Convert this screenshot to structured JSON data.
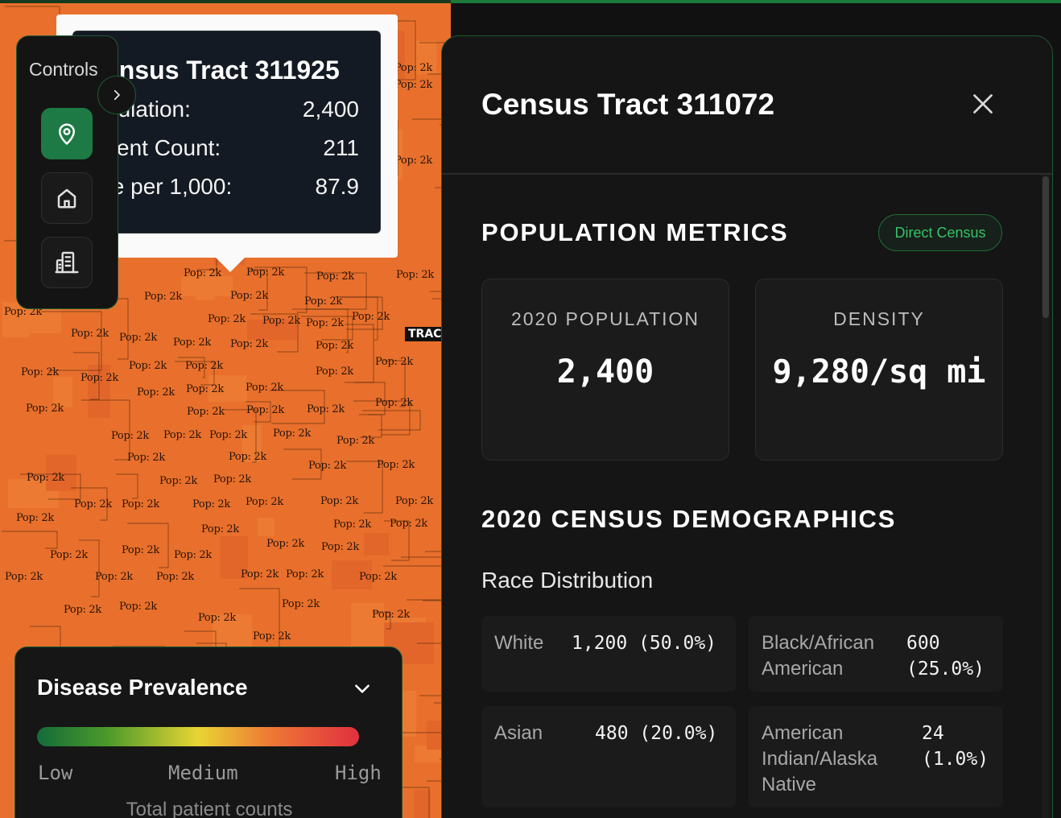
{
  "map": {
    "tract_label": "Pop: 2k",
    "selected_badge": "TRAC",
    "colors": {
      "fill": "#e8702c",
      "border": "#3a1a08"
    }
  },
  "tooltip": {
    "title": "ensus Tract 311925",
    "rows": [
      {
        "label": "pulation:",
        "value": "2,400"
      },
      {
        "label": "tient Count:",
        "value": "211"
      },
      {
        "label": "te per 1,000:",
        "value": "87.9"
      }
    ]
  },
  "controls": {
    "title": "Controls",
    "buttons": [
      {
        "icon": "map-pin-icon",
        "active": true
      },
      {
        "icon": "home-icon",
        "active": false
      },
      {
        "icon": "building-icon",
        "active": false
      }
    ]
  },
  "legend": {
    "title": "Disease Prevalence",
    "low": "Low",
    "medium": "Medium",
    "high": "High",
    "subtitle": "Total patient counts"
  },
  "panel": {
    "title": "Census Tract 311072",
    "population_metrics": {
      "heading": "POPULATION METRICS",
      "badge": "Direct Census",
      "cards": [
        {
          "label": "2020 POPULATION",
          "value": "2,400"
        },
        {
          "label": "DENSITY",
          "value": "9,280/sq mi"
        }
      ]
    },
    "demographics": {
      "heading": "2020 CENSUS DEMOGRAPHICS",
      "race_heading": "Race Distribution",
      "race": [
        {
          "name": "White",
          "value": "1,200 (50.0%)"
        },
        {
          "name": "Black/African American",
          "value": "600\n(25.0%)"
        },
        {
          "name": "Asian",
          "value": "480 (20.0%)"
        },
        {
          "name": "American Indian/Alaska Native",
          "value": "24\n(1.0%)"
        }
      ]
    }
  },
  "accent": "#1d7a44"
}
